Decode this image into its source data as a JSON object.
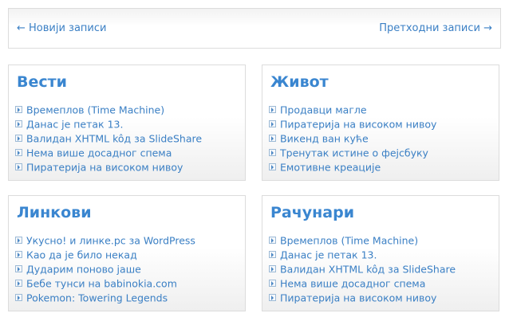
{
  "nav": {
    "newer": "← Новији записи",
    "older": "Претходни записи →"
  },
  "boxes": [
    {
      "title": "Вести",
      "items": [
        "Времеплов (Time Machine)",
        "Данас је петак 13.",
        "Валидан XHTML kôд за SlideShare",
        "Нема више досадног спема",
        "Пиратерија на високом нивоу"
      ]
    },
    {
      "title": "Живот",
      "items": [
        "Продавци магле",
        "Пиратерија на високом нивоу",
        "Викенд ван куће",
        "Тренутак истине о фејсбуку",
        "Емотивне креације"
      ]
    },
    {
      "title": "Линкови",
      "items": [
        "Укусно! и линке.рс за WordPress",
        "Као да је било некад",
        "Дударим поново јаше",
        "Бебе тунси на babinokia.com",
        "Pokemon: Towering Legends"
      ]
    },
    {
      "title": "Рачунари",
      "items": [
        "Времеплов (Time Machine)",
        "Данас је петак 13.",
        "Валидан XHTML kôд за SlideShare",
        "Нема више досадног спема",
        "Пиратерија на високом нивоу"
      ]
    }
  ]
}
